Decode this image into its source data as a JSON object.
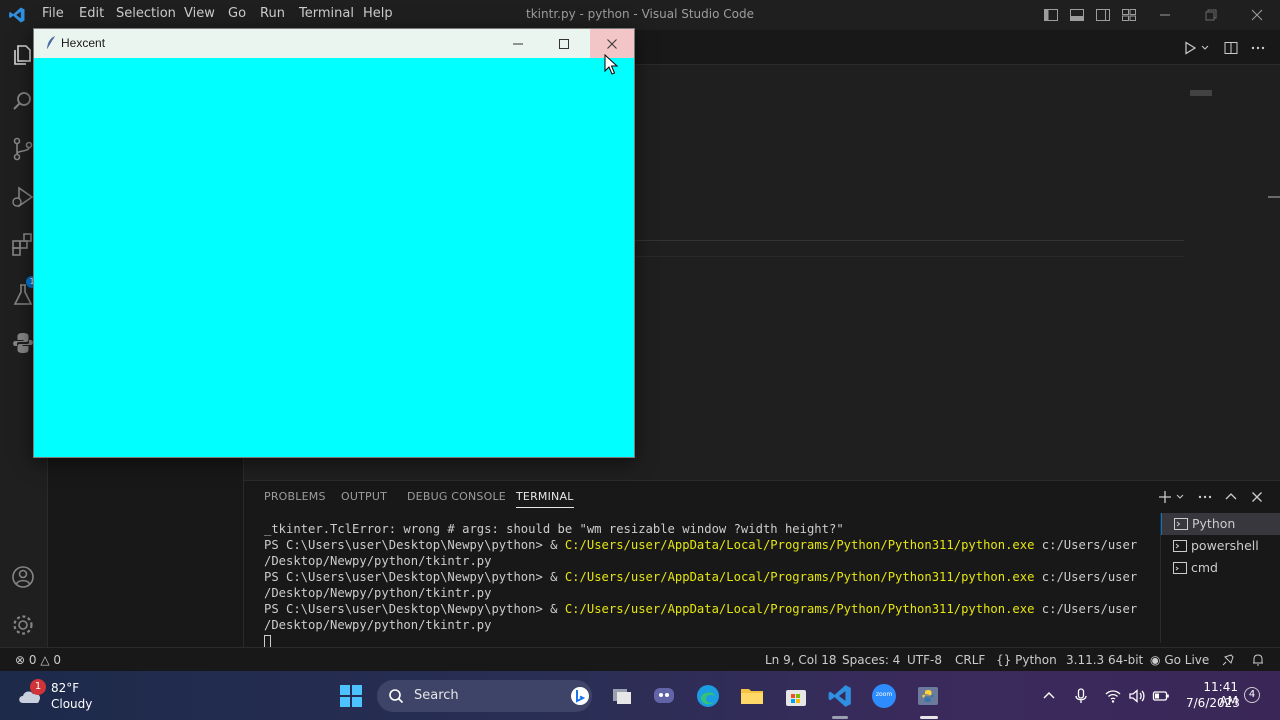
{
  "vscode": {
    "menu": [
      "File",
      "Edit",
      "Selection",
      "View",
      "Go",
      "Run",
      "Terminal",
      "Help"
    ],
    "window_title": "tkintr.py - python - Visual Studio Code",
    "extensions_badge": "1",
    "panel": {
      "tabs": [
        "PROBLEMS",
        "OUTPUT",
        "DEBUG CONSOLE",
        "TERMINAL"
      ],
      "active_tab": "TERMINAL"
    },
    "terminal": {
      "lines": [
        {
          "text": "_tkinter.TclError: wrong # args: should be \"wm resizable window ?width height?\""
        },
        {
          "prompt": "PS C:\\Users\\user\\Desktop\\Newpy\\python> & ",
          "path": "C:/Users/user/AppData/Local/Programs/Python/Python311/python.exe",
          "rest": " c:/Users/user"
        },
        {
          "text": "/Desktop/Newpy/python/tkintr.py"
        },
        {
          "prompt": "PS C:\\Users\\user\\Desktop\\Newpy\\python> & ",
          "path": "C:/Users/user/AppData/Local/Programs/Python/Python311/python.exe",
          "rest": " c:/Users/user"
        },
        {
          "text": "/Desktop/Newpy/python/tkintr.py"
        },
        {
          "prompt": "PS C:\\Users\\user\\Desktop\\Newpy\\python> & ",
          "path": "C:/Users/user/AppData/Local/Programs/Python/Python311/python.exe",
          "rest": " c:/Users/user"
        },
        {
          "text": "/Desktop/Newpy/python/tkintr.py"
        }
      ],
      "sessions": [
        "Python",
        "powershell",
        "cmd"
      ]
    },
    "statusbar": {
      "errors": "0",
      "warnings": "0",
      "position": "Ln 9, Col 18",
      "spaces": "Spaces: 4",
      "encoding": "UTF-8",
      "eol": "CRLF",
      "language": "Python",
      "interpreter": "3.11.3 64-bit",
      "go_live": "Go Live"
    }
  },
  "tk_window": {
    "title": "Hexcent",
    "background_color": "#00ffff"
  },
  "taskbar": {
    "weather_badge": "1",
    "temperature": "82°F",
    "condition": "Cloudy",
    "search_label": "Search",
    "zoom_label": "zoom",
    "time": "11:41 AM",
    "date": "7/6/2023",
    "notifications": "4"
  },
  "colors": {
    "accent": "#0078d4",
    "terminal_path": "#e5e510",
    "tk_canvas": "#00ffff"
  }
}
